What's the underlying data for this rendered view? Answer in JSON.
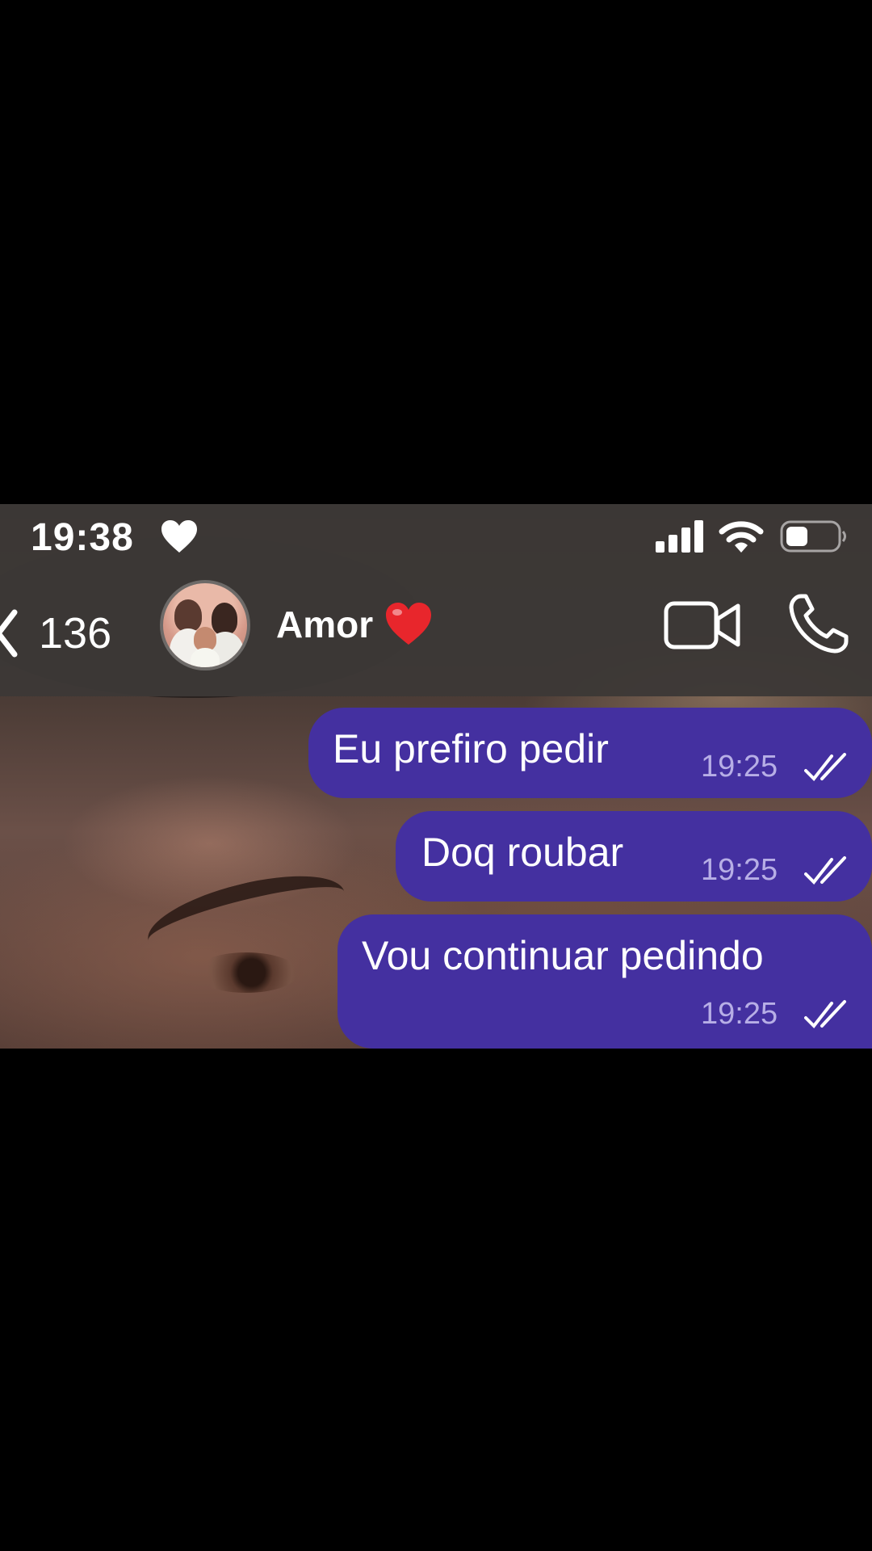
{
  "status_bar": {
    "time": "19:38"
  },
  "header": {
    "back_count": "136",
    "contact_name": "Amor"
  },
  "messages": [
    {
      "text": "Eu prefiro pedir",
      "time": "19:25",
      "status": "read"
    },
    {
      "text": "Doq roubar",
      "time": "19:25",
      "status": "read"
    },
    {
      "text": "Vou continuar pedindo",
      "time": "19:25",
      "status": "read"
    }
  ],
  "colors": {
    "bubble_outgoing": "#4430a0",
    "heart": "#e8262c"
  },
  "icons": {
    "status_heart": "heart-icon",
    "signal": "cellular-signal-icon",
    "wifi": "wifi-icon",
    "battery": "battery-icon",
    "back": "chevron-left-icon",
    "contact_emoji": "red-heart-icon",
    "video": "video-camera-icon",
    "call": "phone-icon",
    "read_receipt": "double-check-icon"
  }
}
